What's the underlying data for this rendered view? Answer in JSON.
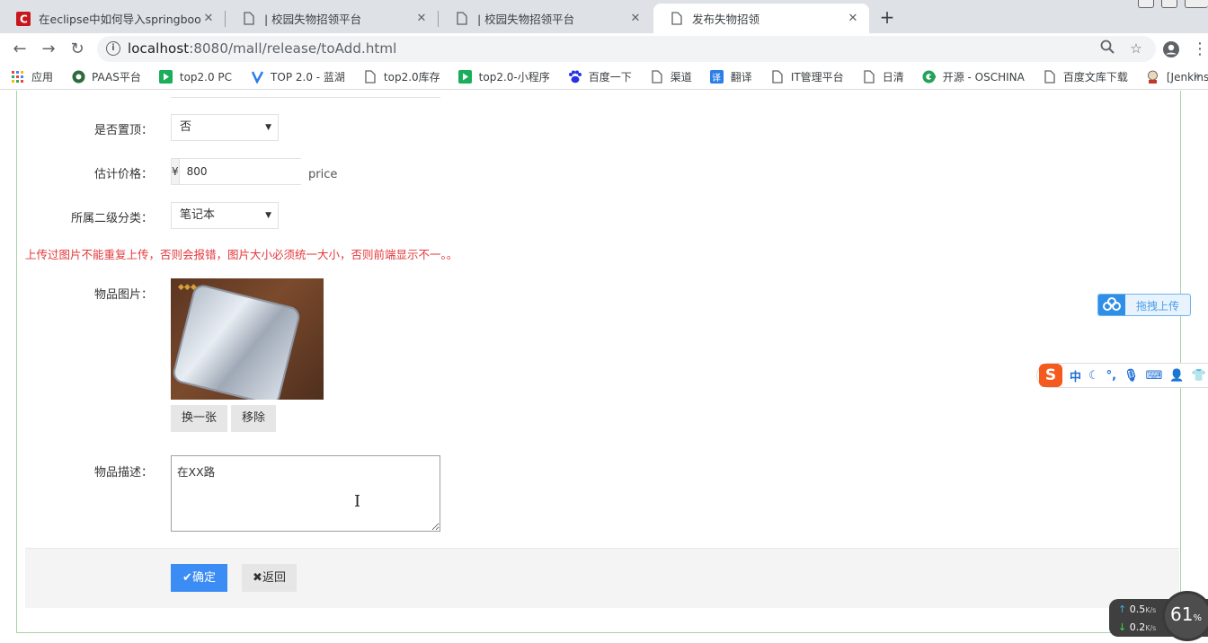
{
  "browser": {
    "tabs": [
      {
        "title": "在eclipse中如何导入springboot",
        "favicon": "c-brand-icon"
      },
      {
        "title": "| 校园失物招领平台",
        "favicon": "page-icon"
      },
      {
        "title": "| 校园失物招领平台",
        "favicon": "page-icon"
      },
      {
        "title": "发布失物招领",
        "favicon": "page-icon"
      }
    ],
    "address": {
      "host": "localhost",
      "rest": ":8080/mall/release/toAdd.html"
    },
    "bookmarks": [
      {
        "label": "应用",
        "icon": "apps-grid-icon"
      },
      {
        "label": "PAAS平台",
        "icon": "paas-icon"
      },
      {
        "label": "top2.0 PC",
        "icon": "play-icon"
      },
      {
        "label": "TOP 2.0 - 蓝湖",
        "icon": "lanhu-icon"
      },
      {
        "label": "top2.0库存",
        "icon": "page-icon"
      },
      {
        "label": "top2.0-小程序",
        "icon": "play-icon"
      },
      {
        "label": "百度一下",
        "icon": "baidu-paw-icon"
      },
      {
        "label": "渠道",
        "icon": "page-icon"
      },
      {
        "label": "翻译",
        "icon": "translate-icon"
      },
      {
        "label": "IT管理平台",
        "icon": "page-icon"
      },
      {
        "label": "日清",
        "icon": "page-icon"
      },
      {
        "label": "开源 - OSCHINA",
        "icon": "oschina-icon"
      },
      {
        "label": "百度文库下载",
        "icon": "page-icon"
      },
      {
        "label": "[Jenkins]",
        "icon": "jenkins-icon"
      }
    ]
  },
  "form": {
    "top_label": "是否置顶：",
    "top_value": "否",
    "price_label": "估计价格：",
    "price_prefix": "¥",
    "price_value": "800",
    "price_aux": "price",
    "category_label": "所属二级分类：",
    "category_value": "笔记本",
    "warning": "上传过图片不能重复上传，否则会报错，图片大小必须统一大小，否则前端显示不一。。",
    "image_label": "物品图片：",
    "replace_button": "换一张",
    "remove_button": "移除",
    "desc_label": "物品描述：",
    "desc_value": "在XX路",
    "submit_button": "✔确定",
    "back_button": "✖返回"
  },
  "widgets": {
    "drag_upload": "拖拽上传",
    "ime_mode": "中",
    "net_up": "0.5",
    "net_down": "0.2",
    "net_unit": "K/s",
    "gauge": "61",
    "gauge_unit": "%"
  },
  "colors": {
    "primary_button": "#3c8cf5",
    "warning_text": "#e4393c",
    "frame_border": "#a9d3a9"
  }
}
